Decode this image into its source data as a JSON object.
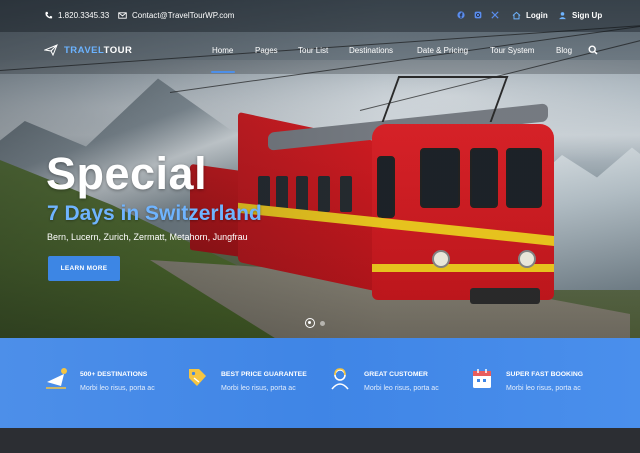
{
  "topbar": {
    "phone": "1.820.3345.33",
    "email": "Contact@TravelTourWP.com",
    "social_icons": [
      "facebook-icon",
      "instagram-icon",
      "x-icon"
    ],
    "login_label": "Login",
    "signup_label": "Sign Up"
  },
  "brand": {
    "part1": "TRAVEL",
    "part2": "TOUR"
  },
  "nav": {
    "items": [
      "Home",
      "Pages",
      "Tour List",
      "Destinations",
      "Date & Pricing",
      "Tour System",
      "Blog"
    ],
    "active": "Home"
  },
  "hero": {
    "title": "Special",
    "subtitle": "7 Days in Switzerland",
    "places": "Bern, Lucern, Zurich, Zermatt, Metahorn, Jungfrau",
    "button_label": "LEARN MORE"
  },
  "features": [
    {
      "icon": "plane-destination-icon",
      "title": "500+ DESTINATIONS",
      "desc": "Morbi leo risus, porta ac"
    },
    {
      "icon": "price-tag-icon",
      "title": "BEST PRICE GUARANTEE",
      "desc": "Morbi leo risus, porta ac"
    },
    {
      "icon": "customer-support-icon",
      "title": "GREAT CUSTOMER",
      "desc": "Morbi leo risus, porta ac"
    },
    {
      "icon": "calendar-booking-icon",
      "title": "SUPER FAST BOOKING",
      "desc": "Morbi leo risus, porta ac"
    }
  ],
  "colors": {
    "accent": "#3d86e4",
    "subtitle_blue": "#6fb4ff",
    "train_red": "#d61b21",
    "stripe_yellow": "#f1cb1e"
  }
}
